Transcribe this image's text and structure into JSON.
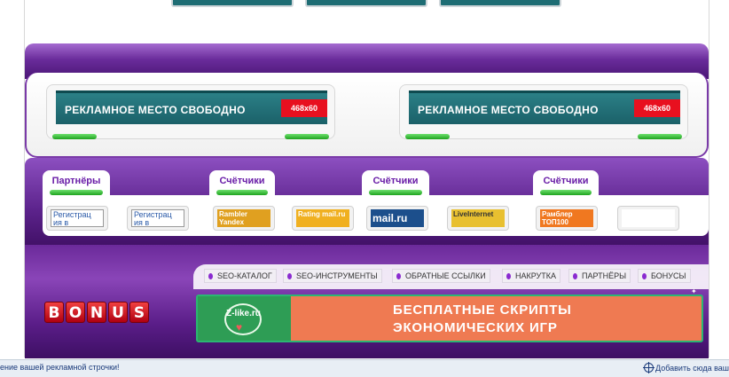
{
  "ad_slots": [
    {
      "text": "РЕКЛАМНОЕ  МЕСТО СВОБОДНО",
      "size": "468x60"
    },
    {
      "text": "РЕКЛАМНОЕ  МЕСТО СВОБОДНО",
      "size": "468x60"
    }
  ],
  "tabs": [
    "Партнёры",
    "Счётчики",
    "Счётчики",
    "Счётчики"
  ],
  "counters": [
    {
      "label": "Регистрац ия в",
      "icon": "broken-image-icon",
      "bg": "#ffffff"
    },
    {
      "label": "Регистрац ия в",
      "icon": "broken-image-icon",
      "bg": "#ffffff"
    },
    {
      "label": "Rambler Yandex",
      "icon": "yandex-counter-icon",
      "bg": "#e0a020"
    },
    {
      "label": "Rating mail.ru",
      "icon": "rating-counter-icon",
      "bg": "#f0b020"
    },
    {
      "label": "mail.ru",
      "icon": "mailru-counter-icon",
      "bg": "#1c4f8c"
    },
    {
      "label": "LiveInternet",
      "icon": "liveinternet-counter-icon",
      "bg": "#e8c030"
    },
    {
      "label": "Рамблер ТОП100",
      "icon": "rambler-top100-icon",
      "bg": "#f07820"
    },
    {
      "label": "",
      "icon": "empty-counter",
      "bg": "#ffffff"
    }
  ],
  "nav": [
    "SEO-КАТАЛОГ",
    "SEO-ИНСТРУМЕНТЫ",
    "ОБРАТНЫЕ ССЫЛКИ",
    "НАКРУТКА",
    "ПАРТНЁРЫ",
    "БОНУСЫ"
  ],
  "bonus_letters": [
    "B",
    "O",
    "N",
    "U",
    "S"
  ],
  "promo": {
    "logo": "Z-like.ru",
    "line1": "БЕСПЛАТНЫЕ СКРИПТЫ",
    "line2": "ЭКОНОМИЧЕСКИХ ИГР"
  },
  "status": {
    "left": "ение вашей рекламной строчки!",
    "right": "Добавить сюда ваш"
  },
  "colors": {
    "purple": "#6a2c9b",
    "ad_teal": "#2b7f86",
    "ad_red": "#e8101f",
    "promo_orange": "#ef7a52",
    "promo_green": "#2e9d55"
  }
}
